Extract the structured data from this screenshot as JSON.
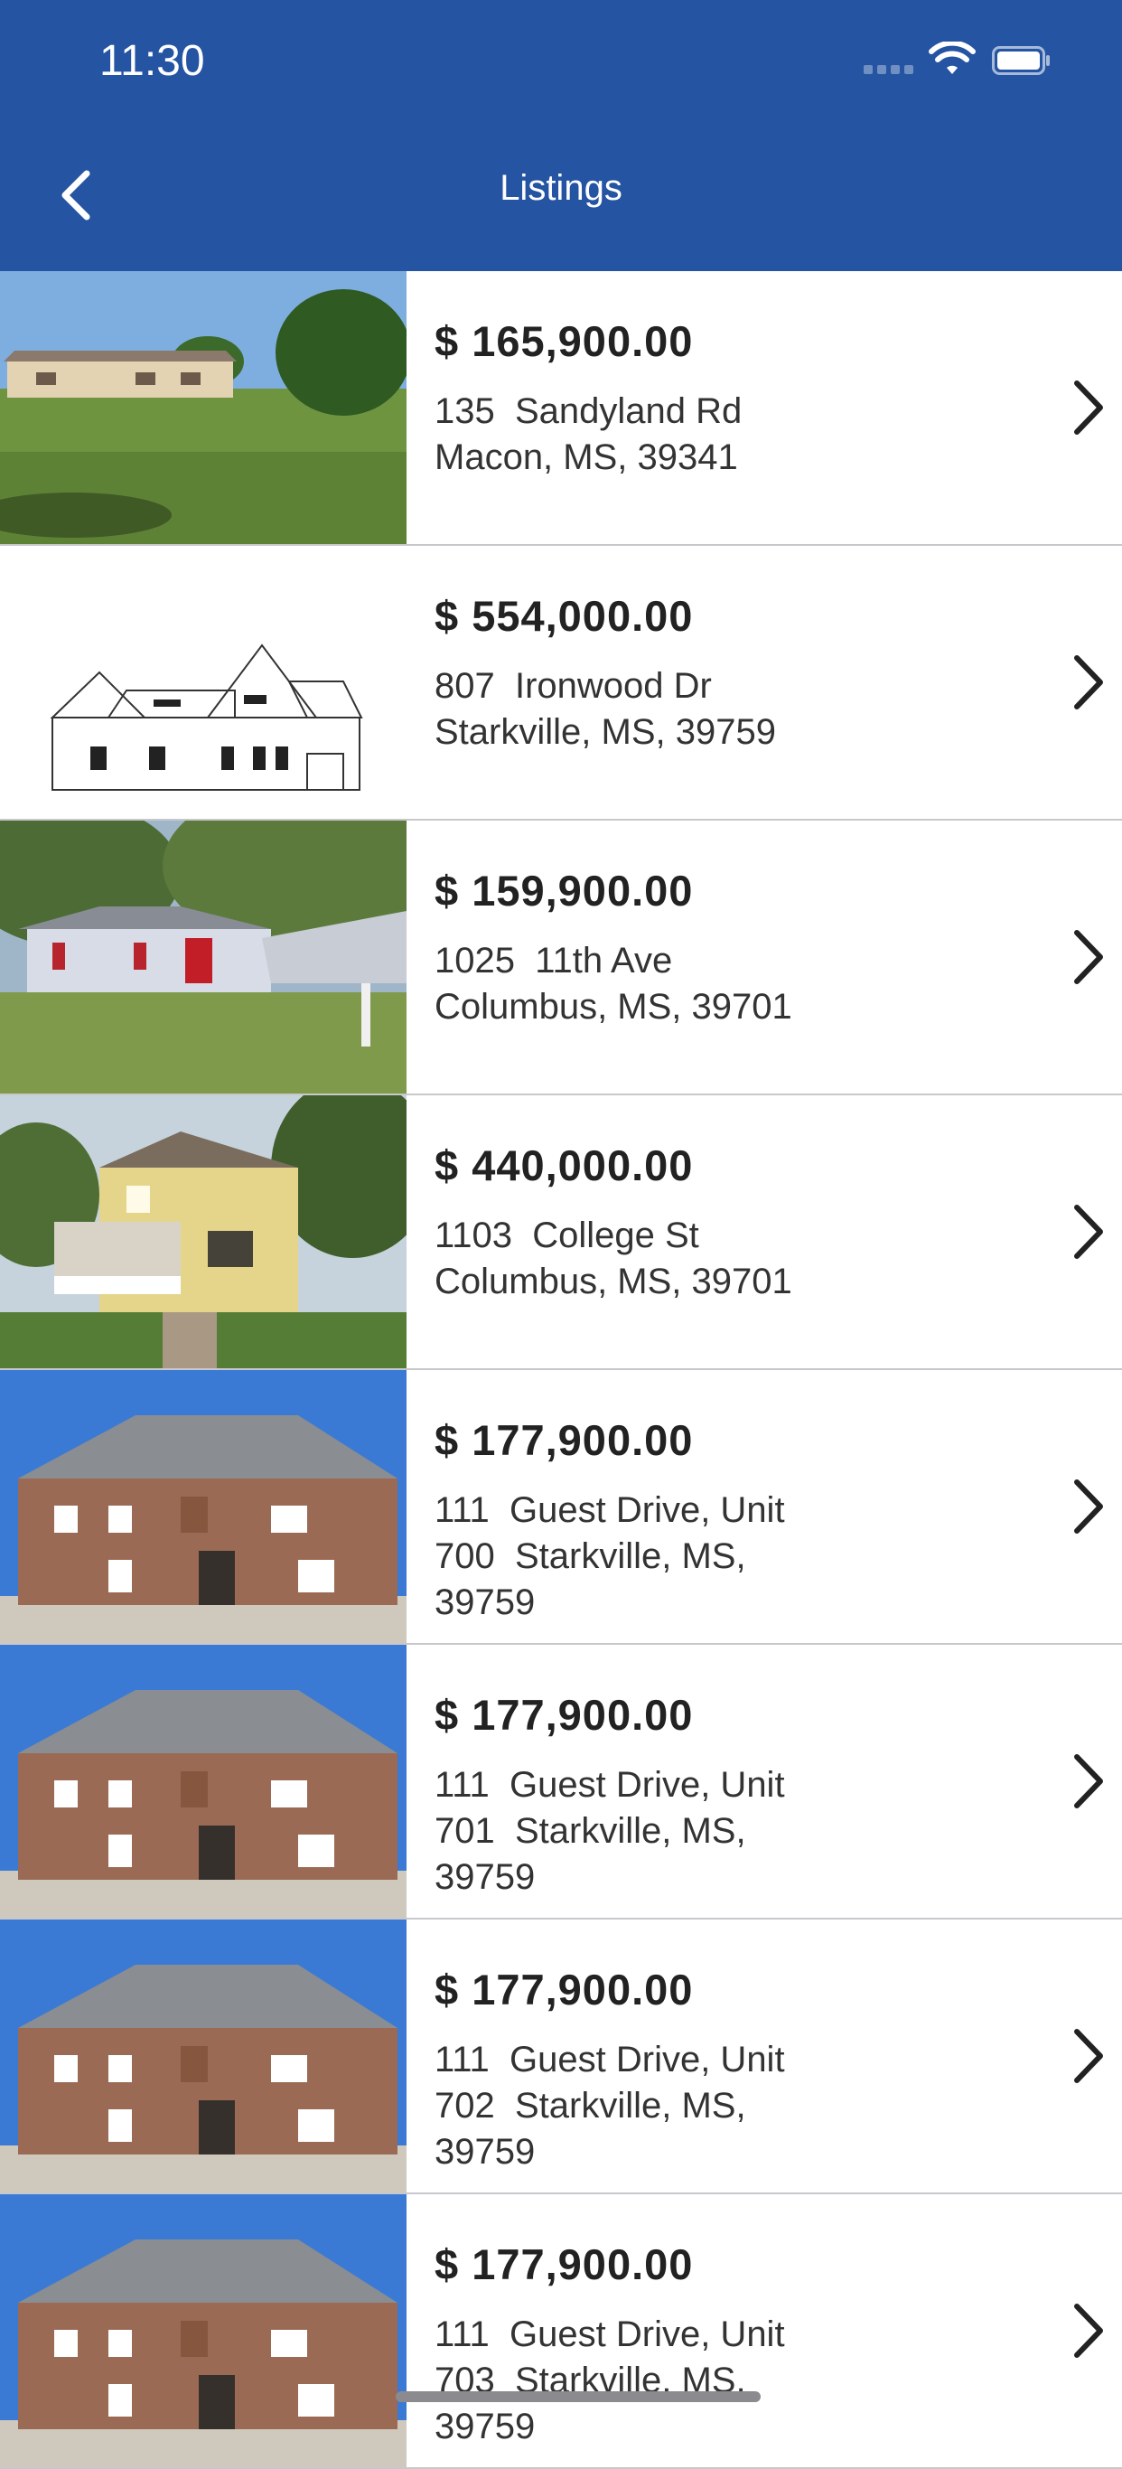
{
  "status_bar": {
    "time": "11:30",
    "signal_icon": "cellular-signal-icon",
    "wifi_icon": "wifi-icon",
    "battery_icon": "battery-icon"
  },
  "nav": {
    "back_icon": "chevron-left-icon",
    "title": "Listings"
  },
  "colors": {
    "header": "#2454a2",
    "divider": "#c8c8cc",
    "text_primary": "#222222"
  },
  "listings": [
    {
      "price": "$ 165,900.00",
      "address": "135  Sandyland Rd\nMacon, MS, 39341",
      "image": "manufactured-home-photo"
    },
    {
      "price": "$ 554,000.00",
      "address": "807  Ironwood Dr\nStarkville, MS, 39759",
      "image": "house-sketch-drawing"
    },
    {
      "price": "$ 159,900.00",
      "address": "1025  11th Ave\nColumbus, MS, 39701",
      "image": "ranch-home-photo"
    },
    {
      "price": "$ 440,000.00",
      "address": "1103  College St\nColumbus, MS, 39701",
      "image": "victorian-home-photo"
    },
    {
      "price": "$ 177,900.00",
      "address": "111  Guest Drive, Unit\n700  Starkville, MS,\n39759",
      "image": "brick-townhome-photo"
    },
    {
      "price": "$ 177,900.00",
      "address": "111  Guest Drive, Unit\n701  Starkville, MS,\n39759",
      "image": "brick-townhome-photo"
    },
    {
      "price": "$ 177,900.00",
      "address": "111  Guest Drive, Unit\n702  Starkville, MS,\n39759",
      "image": "brick-townhome-photo"
    },
    {
      "price": "$ 177,900.00",
      "address": "111  Guest Drive, Unit\n703  Starkville, MS,\n39759",
      "image": "brick-townhome-photo"
    }
  ]
}
